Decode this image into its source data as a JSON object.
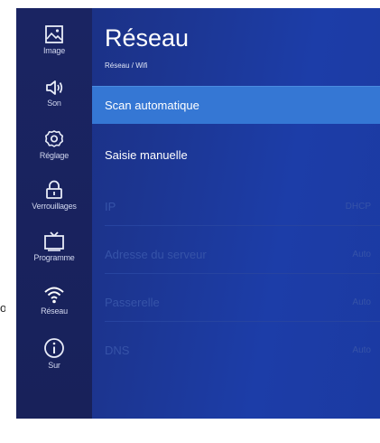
{
  "edge_text": "ot",
  "sidebar": {
    "items": [
      {
        "label": "Image",
        "icon": "image-icon"
      },
      {
        "label": "Son",
        "icon": "speaker-icon"
      },
      {
        "label": "Réglage",
        "icon": "gear-icon"
      },
      {
        "label": "Verrouillages",
        "icon": "lock-icon"
      },
      {
        "label": "Programme",
        "icon": "tv-icon"
      },
      {
        "label": "Réseau",
        "icon": "wifi-icon"
      },
      {
        "label": "Sur",
        "icon": "info-icon"
      }
    ]
  },
  "header": {
    "title": "Réseau",
    "breadcrumb": "Réseau / Wifi"
  },
  "menu": {
    "items": [
      {
        "label": "Scan automatique",
        "value": "",
        "state": "selected"
      },
      {
        "label": "Saisie manuelle",
        "value": "",
        "state": "normal"
      },
      {
        "label": "IP",
        "value": "DHCP",
        "state": "disabled"
      },
      {
        "label": "Adresse du serveur",
        "value": "Auto",
        "state": "disabled"
      },
      {
        "label": "Passerelle",
        "value": "Auto",
        "state": "disabled"
      },
      {
        "label": "DNS",
        "value": "Auto",
        "state": "disabled"
      }
    ]
  },
  "colors": {
    "background": "#1c3590",
    "sidebar": "#1a2462",
    "selected": "#3577d4",
    "text": "#ffffff"
  }
}
